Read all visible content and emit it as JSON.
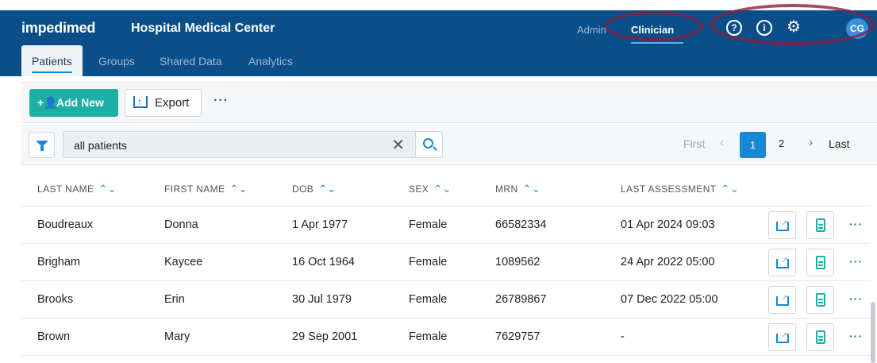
{
  "header": {
    "logo": "impedimed",
    "hospital": "Hospital Medical Center",
    "roles": [
      "Admin",
      "Clinician"
    ],
    "active_role": "Clinician",
    "icons": [
      "help-circle-icon",
      "info-circle-icon",
      "gear-icon"
    ],
    "avatar_initials": "CG",
    "brand_color": "#0b4f8a"
  },
  "nav": {
    "tabs": [
      "Patients",
      "Groups",
      "Shared Data",
      "Analytics"
    ],
    "active": "Patients"
  },
  "toolbar": {
    "add_label": "Add New",
    "export_label": "Export",
    "more_label": "···"
  },
  "filter": {
    "search_value": "all patients",
    "clear_label": "✕"
  },
  "pager": {
    "first": "First",
    "prev": "‹",
    "pages": [
      "1",
      "2"
    ],
    "current": "1",
    "next": "›",
    "last": "Last"
  },
  "table": {
    "columns": [
      "LAST NAME",
      "FIRST NAME",
      "DOB",
      "SEX",
      "MRN",
      "LAST ASSESSMENT"
    ],
    "sort_glyph": "⌃⌄",
    "rows": [
      [
        "Boudreaux",
        "Donna",
        "1 Apr 1977",
        "Female",
        "66582334",
        "01 Apr 2024 09:03"
      ],
      [
        "Brigham",
        "Kaycee",
        "16 Oct 1964",
        "Female",
        "1089562",
        "24 Apr 2022 05:00"
      ],
      [
        "Brooks",
        "Erin",
        "30 Jul 1979",
        "Female",
        "26789867",
        "07 Dec 2022 05:00"
      ],
      [
        "Brown",
        "Mary",
        "29 Sep 2001",
        "Female",
        "7629757",
        "-"
      ]
    ],
    "row_more": "···"
  }
}
